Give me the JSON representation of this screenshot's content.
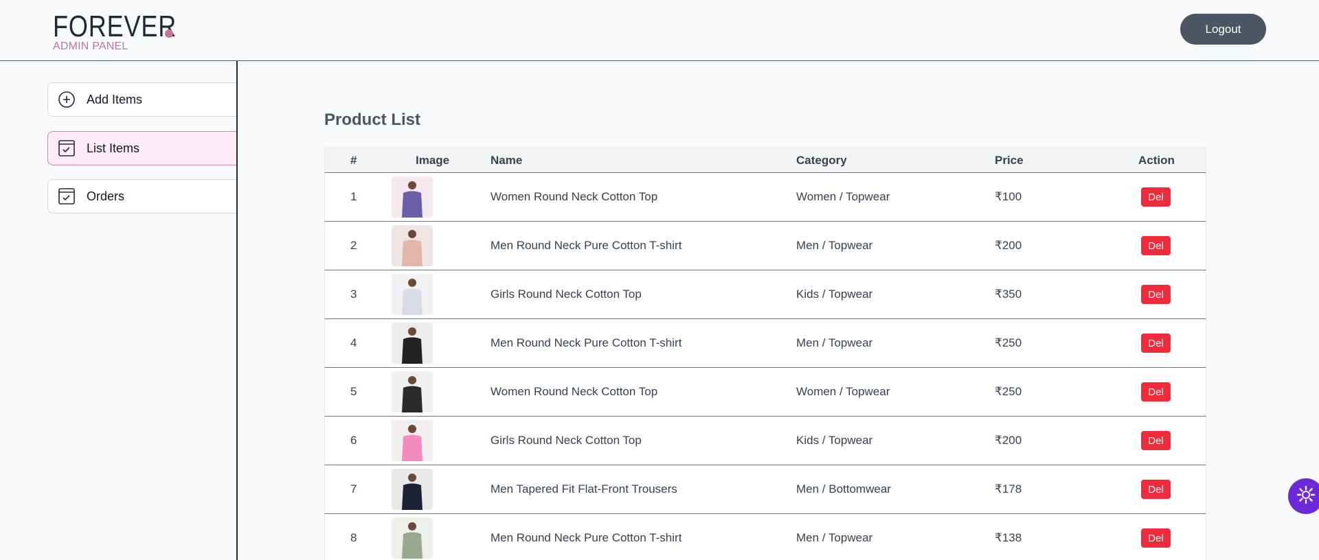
{
  "header": {
    "logo_text": "FOREVER",
    "logo_subtitle": "ADMIN PANEL",
    "logout_label": "Logout",
    "accent_color": "#c5739f"
  },
  "sidebar": {
    "items": [
      {
        "label": "Add Items",
        "icon": "add-circle-icon",
        "active": false
      },
      {
        "label": "List Items",
        "icon": "checklist-icon",
        "active": true
      },
      {
        "label": "Orders",
        "icon": "checklist-icon",
        "active": false
      }
    ]
  },
  "main": {
    "title": "Product List",
    "columns": [
      "#",
      "Image",
      "Name",
      "Category",
      "Price",
      "Action"
    ],
    "rows": [
      {
        "num": "1",
        "name": "Women Round Neck Cotton Top",
        "category": "Women / Topwear",
        "price": "₹100",
        "action": "Del",
        "image": "product-image"
      },
      {
        "num": "2",
        "name": "Men Round Neck Pure Cotton T-shirt",
        "category": "Men / Topwear",
        "price": "₹200",
        "action": "Del",
        "image": "product-image"
      },
      {
        "num": "3",
        "name": "Girls Round Neck Cotton Top",
        "category": "Kids / Topwear",
        "price": "₹350",
        "action": "Del",
        "image": "product-image"
      },
      {
        "num": "4",
        "name": "Men Round Neck Pure Cotton T-shirt",
        "category": "Men / Topwear",
        "price": "₹250",
        "action": "Del",
        "image": "product-image"
      },
      {
        "num": "5",
        "name": "Women Round Neck Cotton Top",
        "category": "Women / Topwear",
        "price": "₹250",
        "action": "Del",
        "image": "product-image"
      },
      {
        "num": "6",
        "name": "Girls Round Neck Cotton Top",
        "category": "Kids / Topwear",
        "price": "₹200",
        "action": "Del",
        "image": "product-image"
      },
      {
        "num": "7",
        "name": "Men Tapered Fit Flat-Front Trousers",
        "category": "Men / Bottomwear",
        "price": "₹178",
        "action": "Del",
        "image": "product-image"
      },
      {
        "num": "8",
        "name": "Men Round Neck Pure Cotton T-shirt",
        "category": "Men / Topwear",
        "price": "₹138",
        "action": "Del",
        "image": "product-image"
      }
    ]
  },
  "floating_button": {
    "icon": "settings-gear-icon",
    "color": "#6d28d9"
  }
}
